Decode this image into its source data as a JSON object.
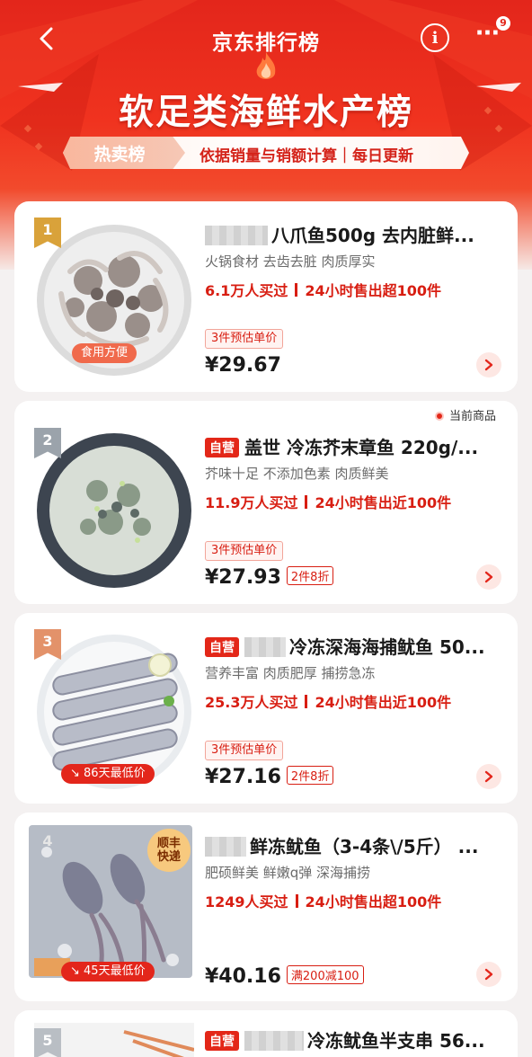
{
  "header": {
    "app_title": "京东排行榜",
    "rank_title": "软足类海鲜水产榜",
    "hot_tab": "热卖榜",
    "criteria_text": "依据销量与销额计算｜每日更新",
    "more_badge": "9"
  },
  "products": [
    {
      "rank": "1",
      "name": "八爪鱼500g 去内脏鲜...",
      "self_operated": false,
      "tags": "火锅食材  去齿去脏  肉质厚实",
      "buyers": "6.1万人买过",
      "sales_24h": "24小时售出超100件",
      "estimate_label": "3件预估单价",
      "price": "¥29.67",
      "promo": "",
      "thumb_label": "食用方便",
      "current": ""
    },
    {
      "rank": "2",
      "name": "盖世 冷冻芥末章鱼 220g/...",
      "self_operated": true,
      "self_label": "自营",
      "tags": "芥味十足  不添加色素  肉质鲜美",
      "buyers": "11.9万人买过",
      "sales_24h": "24小时售出近100件",
      "estimate_label": "3件预估单价",
      "price": "¥27.93",
      "promo": "2件8折",
      "thumb_label": "",
      "current": "当前商品"
    },
    {
      "rank": "3",
      "name": "冷冻深海海捕鱿鱼 50...",
      "self_operated": true,
      "self_label": "自营",
      "tags": "营养丰富  肉质肥厚  捕捞急冻",
      "buyers": "25.3万人买过",
      "sales_24h": "24小时售出近100件",
      "estimate_label": "3件预估单价",
      "price": "¥27.16",
      "promo": "2件8折",
      "thumb_label": "86天最低价",
      "current": ""
    },
    {
      "rank": "4",
      "name": "鲜冻鱿鱼（3-4条\\/5斤） ...",
      "self_operated": false,
      "tags": "肥硕鲜美  鲜嫩q弹  深海捕捞",
      "buyers": "1249人买过",
      "sales_24h": "24小时售出超100件",
      "estimate_label": "",
      "price": "¥40.16",
      "promo": "满200减100",
      "thumb_label": "45天最低价",
      "sf_badge": "顺丰\n快递",
      "current": ""
    },
    {
      "rank": "5",
      "name": "冷冻鱿鱼半支串 56...",
      "self_operated": true,
      "self_label": "自营"
    }
  ],
  "colors": {
    "brand_red": "#e3261b",
    "price_red": "#d81e12",
    "gold": "#d9a23a",
    "silver": "#9ba3ab",
    "bronze": "#e3926a"
  },
  "icons": [
    "back-arrow-icon",
    "info-icon",
    "more-icon",
    "flame-icon",
    "chevron-right-icon"
  ]
}
